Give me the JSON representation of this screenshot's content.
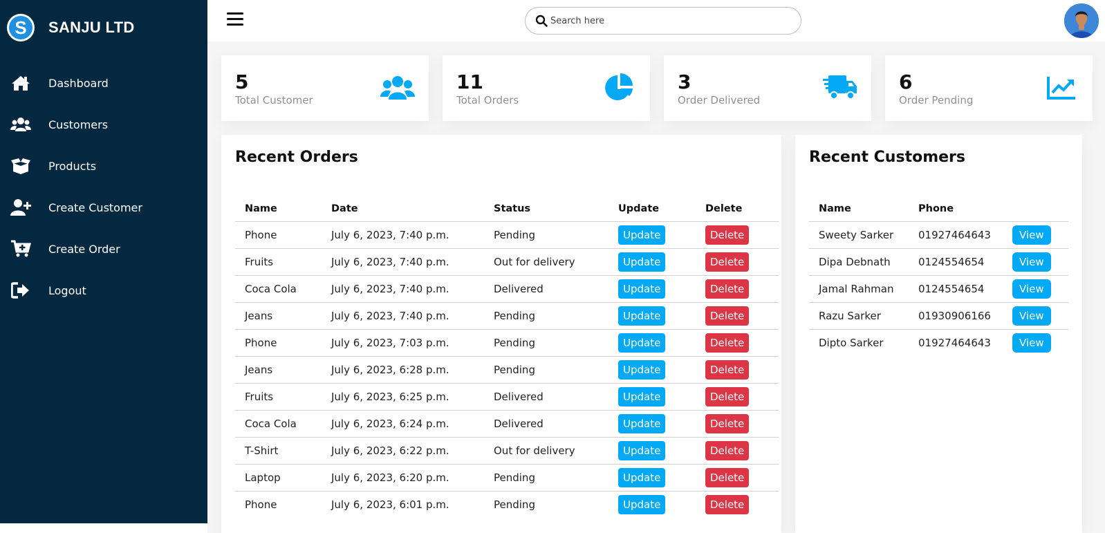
{
  "brand": {
    "logo_letter": "S",
    "name": "SANJU LTD",
    "accent": "#1f8fe0"
  },
  "colors": {
    "sidebar_bg": "#04283f",
    "accent": "#03a9f4",
    "danger": "#dc3545"
  },
  "sidebar": {
    "items": [
      {
        "label": "Dashboard",
        "icon": "home-icon"
      },
      {
        "label": "Customers",
        "icon": "users-icon"
      },
      {
        "label": "Products",
        "icon": "box-icon"
      },
      {
        "label": "Create Customer",
        "icon": "user-plus-icon"
      },
      {
        "label": "Create Order",
        "icon": "cart-plus-icon"
      },
      {
        "label": "Logout",
        "icon": "logout-icon"
      }
    ]
  },
  "topbar": {
    "search_placeholder": "Search here"
  },
  "cards": [
    {
      "number": "5",
      "name": "Total Customer",
      "icon": "users-icon"
    },
    {
      "number": "11",
      "name": "Total Orders",
      "icon": "pie-chart-icon"
    },
    {
      "number": "3",
      "name": "Order Delivered",
      "icon": "truck-icon"
    },
    {
      "number": "6",
      "name": "Order Pending",
      "icon": "trend-chart-icon"
    }
  ],
  "recent_orders": {
    "title": "Recent Orders",
    "headers": [
      "Name",
      "Date",
      "Status",
      "Update",
      "Delete"
    ],
    "update_label": "Update",
    "delete_label": "Delete",
    "rows": [
      {
        "name": "Phone",
        "date": "July 6, 2023, 7:40 p.m.",
        "status": "Pending"
      },
      {
        "name": "Fruits",
        "date": "July 6, 2023, 7:40 p.m.",
        "status": "Out for delivery"
      },
      {
        "name": "Coca Cola",
        "date": "July 6, 2023, 7:40 p.m.",
        "status": "Delivered"
      },
      {
        "name": "Jeans",
        "date": "July 6, 2023, 7:40 p.m.",
        "status": "Pending"
      },
      {
        "name": "Phone",
        "date": "July 6, 2023, 7:03 p.m.",
        "status": "Pending"
      },
      {
        "name": "Jeans",
        "date": "July 6, 2023, 6:28 p.m.",
        "status": "Pending"
      },
      {
        "name": "Fruits",
        "date": "July 6, 2023, 6:25 p.m.",
        "status": "Delivered"
      },
      {
        "name": "Coca Cola",
        "date": "July 6, 2023, 6:24 p.m.",
        "status": "Delivered"
      },
      {
        "name": "T-Shirt",
        "date": "July 6, 2023, 6:22 p.m.",
        "status": "Out for delivery"
      },
      {
        "name": "Laptop",
        "date": "July 6, 2023, 6:20 p.m.",
        "status": "Pending"
      },
      {
        "name": "Phone",
        "date": "July 6, 2023, 6:01 p.m.",
        "status": "Pending"
      }
    ]
  },
  "recent_customers": {
    "title": "Recent Customers",
    "headers": [
      "Name",
      "Phone"
    ],
    "view_label": "View",
    "rows": [
      {
        "name": "Sweety Sarker",
        "phone": "01927464643"
      },
      {
        "name": "Dipa Debnath",
        "phone": "0124554654"
      },
      {
        "name": "Jamal Rahman",
        "phone": "0124554654"
      },
      {
        "name": "Razu Sarker",
        "phone": "01930906166"
      },
      {
        "name": "Dipto Sarker",
        "phone": "01927464643"
      }
    ]
  }
}
